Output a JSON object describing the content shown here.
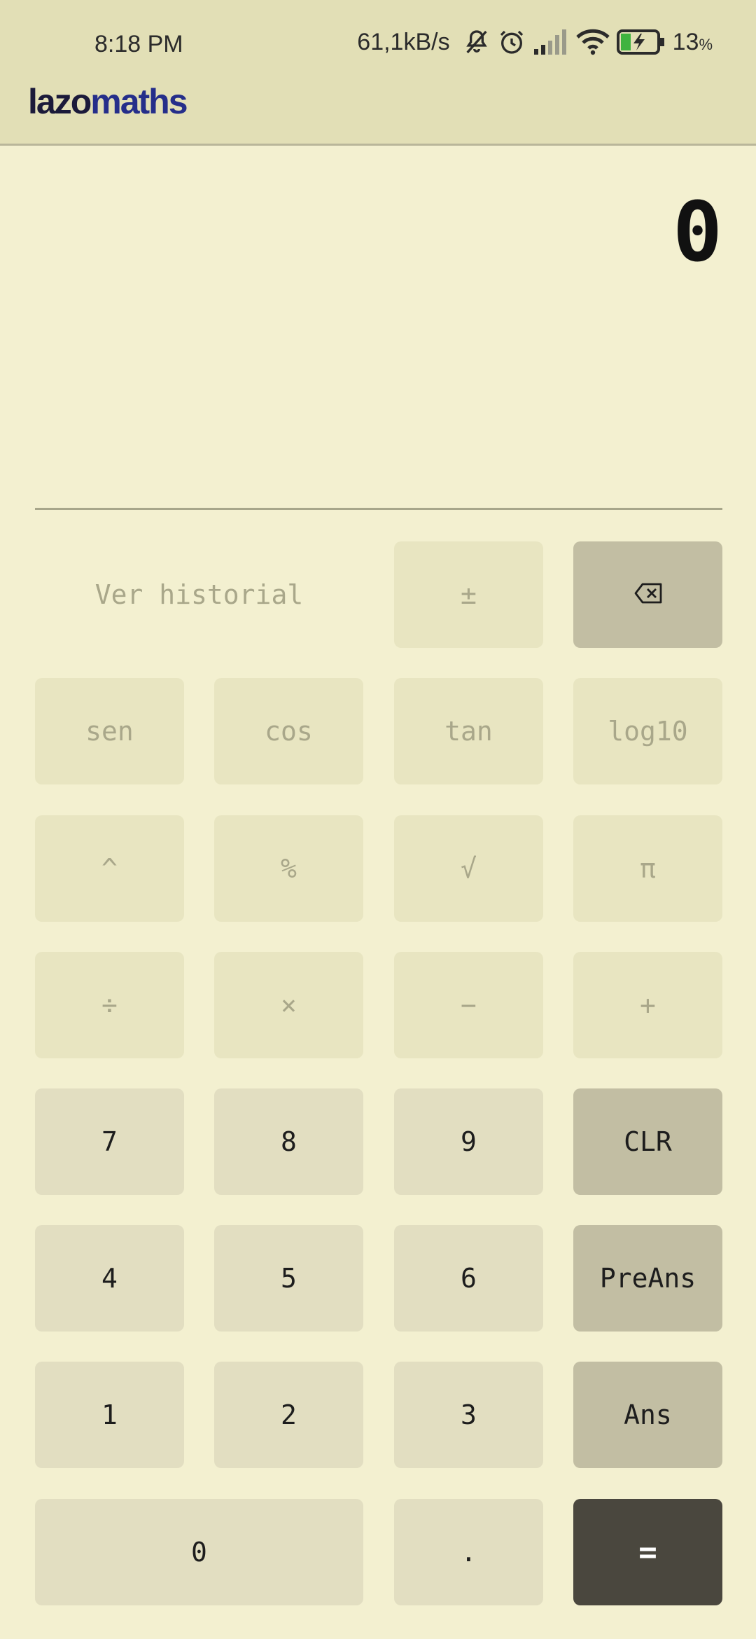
{
  "status_bar": {
    "time": "8:18 PM",
    "net_speed": "61,1kB/s",
    "battery_pct": "13",
    "battery_unit": "%",
    "icons": [
      "mute-bell-icon",
      "alarm-icon",
      "signal-icon",
      "wifi-icon",
      "battery-charging-icon"
    ]
  },
  "app": {
    "logo_part1": "lazo",
    "logo_part2": "maths",
    "colors": {
      "logo_dark": "#1b1a3a",
      "logo_blue": "#252e8a"
    }
  },
  "display": {
    "value": "0"
  },
  "keys": {
    "history": "Ver historial",
    "plus_minus": "±",
    "backspace_icon": "backspace-icon",
    "sen": "sen",
    "cos": "cos",
    "tan": "tan",
    "log10": "log10",
    "power": "^",
    "percent": "%",
    "sqrt": "√",
    "pi": "π",
    "divide": "÷",
    "multiply": "×",
    "minus": "−",
    "plus": "+",
    "seven": "7",
    "eight": "8",
    "nine": "9",
    "clr": "CLR",
    "four": "4",
    "five": "5",
    "six": "6",
    "preans": "PreAns",
    "one": "1",
    "two": "2",
    "three": "3",
    "ans": "Ans",
    "zero": "0",
    "dot": ".",
    "equals": "="
  }
}
